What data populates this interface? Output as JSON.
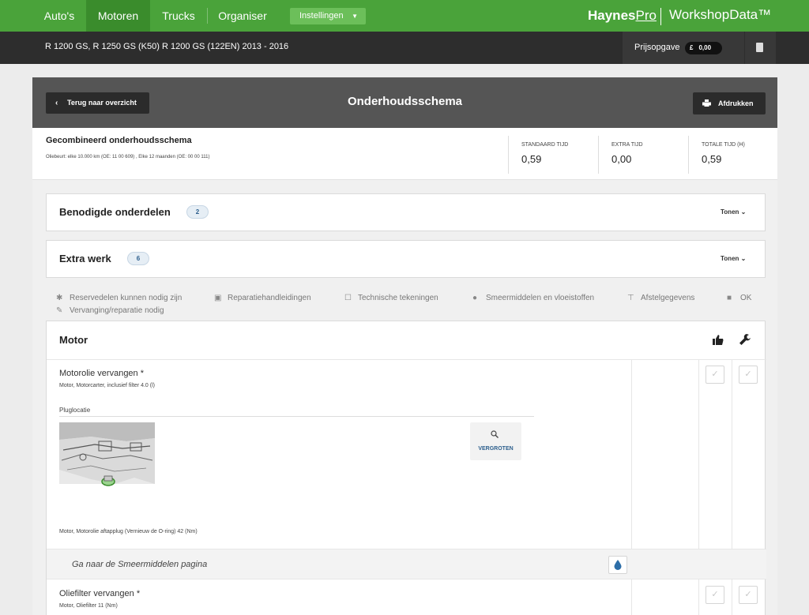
{
  "nav": {
    "tabs": [
      "Auto's",
      "Motoren",
      "Trucks",
      "Organiser"
    ],
    "active_tab": "Motoren",
    "settings_label": "Instellingen",
    "brand_left": "Haynes",
    "brand_left_pro": "Pro",
    "brand_right": "WorkshopData™"
  },
  "vehicle": {
    "title": "R 1200 GS, R 1250 GS (K50) R 1200 GS (122EN) 2013 - 2016",
    "quote_label": "Prijsopgave",
    "currency_symbol": "£",
    "quote_amount": "0,00"
  },
  "header": {
    "back_label": "Terug naar overzicht",
    "title": "Onderhoudsschema",
    "print_label": "Afdrukken"
  },
  "summary": {
    "title": "Gecombineerd onderhoudsschema",
    "subtitle": "Oliebeurt: elke 10.000 km (OE: 11 00 609) ,  Elke 12 maanden (OE: 00 00 111)",
    "times": [
      {
        "label": "STANDAARD TIJD",
        "value": "0,59"
      },
      {
        "label": "EXTRA TIJD",
        "value": "0,00"
      },
      {
        "label": "TOTALE TIJD (H)",
        "value": "0,59"
      }
    ]
  },
  "accordions": [
    {
      "title": "Benodigde onderdelen",
      "count": "2",
      "toggle": "Tonen"
    },
    {
      "title": "Extra werk",
      "count": "6",
      "toggle": "Tonen"
    }
  ],
  "legend": [
    {
      "icon": "asterisk-icon",
      "label": "Reservedelen kunnen nodig zijn"
    },
    {
      "icon": "manual-icon",
      "label": "Reparatiehandleidingen"
    },
    {
      "icon": "drawing-icon",
      "label": "Technische tekeningen"
    },
    {
      "icon": "drop-icon",
      "label": "Smeermiddelen en vloeistoffen"
    },
    {
      "icon": "settings-icon",
      "label": "Afstelgegevens"
    },
    {
      "icon": "thumbs-up-icon",
      "label": "OK"
    },
    {
      "icon": "wrench-icon",
      "label": "Vervanging/reparatie nodig"
    }
  ],
  "section": {
    "title": "Motor",
    "tasks": [
      {
        "title": "Motorolie vervangen  *",
        "subtitle": "Motor,  Motorcarter, inclusief filter 4.0 (l)",
        "location_label": "Pluglocatie",
        "zoom_label": "VERGROTEN",
        "torque": "Motor,  Motorolie aftapplug (Vernieuw de O-ring) 42 (Nm)"
      },
      {
        "title": "Oliefilter vervangen  *",
        "subtitle": "Motor,  Oliefilter 11 (Nm)"
      }
    ],
    "goto_label": "Ga naar de Smeermiddelen pagina"
  },
  "colors": {
    "nav_green": "#4aa33a",
    "nav_active": "#3a8c2c",
    "vehicle_bar": "#2d2d2d",
    "header_grey": "#555555",
    "badge_blue": "#2d5f8d"
  }
}
